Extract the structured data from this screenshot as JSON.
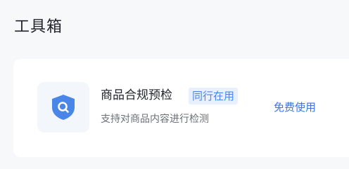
{
  "section": {
    "title": "工具箱"
  },
  "tools": [
    {
      "name": "商品合规预检",
      "tag": "同行在用",
      "description": "支持对商品内容进行检测",
      "action": "免费使用",
      "icon": "shield-search-icon"
    }
  ],
  "colors": {
    "accent": "#3d73e0",
    "icon_blue": "#4a86e8",
    "tag_bg": "#e8f0fd"
  }
}
